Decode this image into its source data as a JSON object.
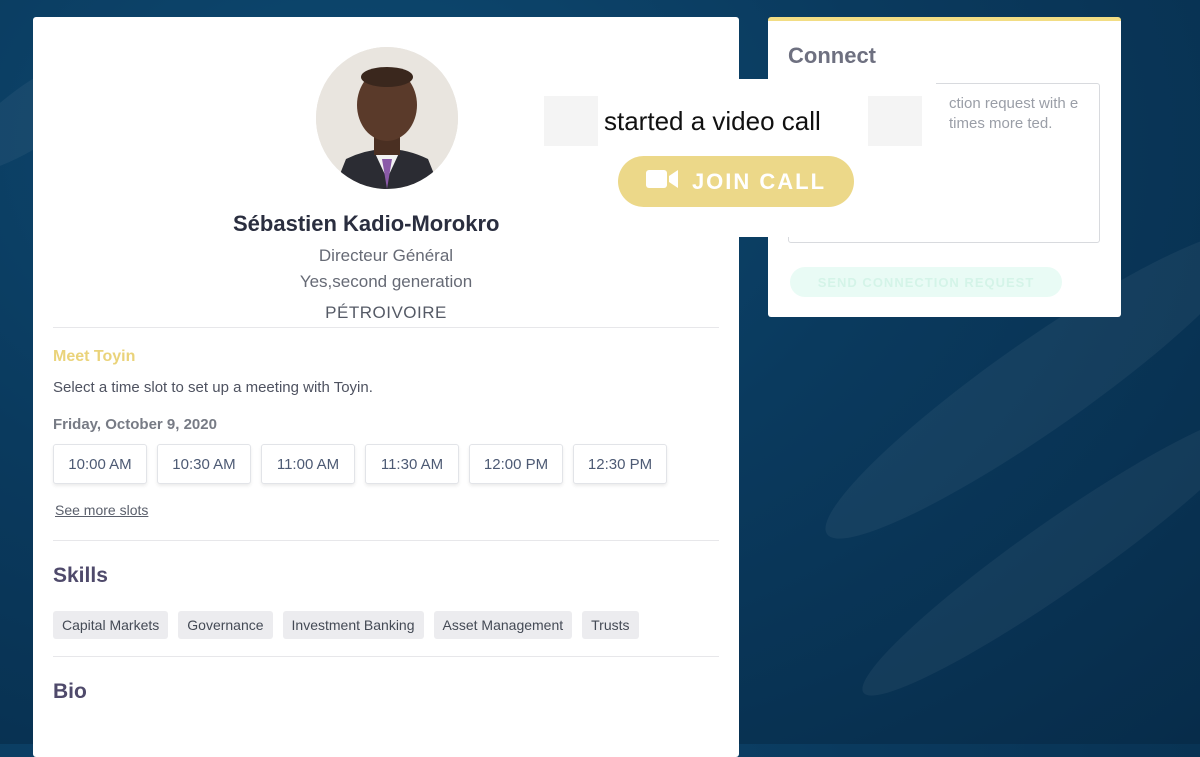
{
  "profile": {
    "name": "Sébastien Kadio-Morokro",
    "title": "Directeur Général",
    "subtitle": "Yes,second generation",
    "company": "PÉTROIVOIRE"
  },
  "meet": {
    "title": "Meet Toyin",
    "description": "Select a time slot to set up a meeting with Toyin.",
    "date": "Friday, October 9, 2020",
    "slots": [
      "10:00 AM",
      "10:30 AM",
      "11:00 AM",
      "11:30 AM",
      "12:00 PM",
      "12:30 PM"
    ],
    "see_more": "See more slots"
  },
  "skills": {
    "title": "Skills",
    "items": [
      "Capital Markets",
      "Governance",
      "Investment Banking",
      "Asset Management",
      "Trusts"
    ]
  },
  "bio": {
    "title": "Bio"
  },
  "connect": {
    "title": "Connect",
    "hint": "ction request with e times more ted.",
    "send_label": "SEND CONNECTION REQUEST"
  },
  "call": {
    "message": "started a video call",
    "join_label": "JOIN CALL"
  },
  "colors": {
    "accent_yellow": "#ecd889",
    "title_purple": "#4f4a6b",
    "background": "#0a3a5e"
  }
}
